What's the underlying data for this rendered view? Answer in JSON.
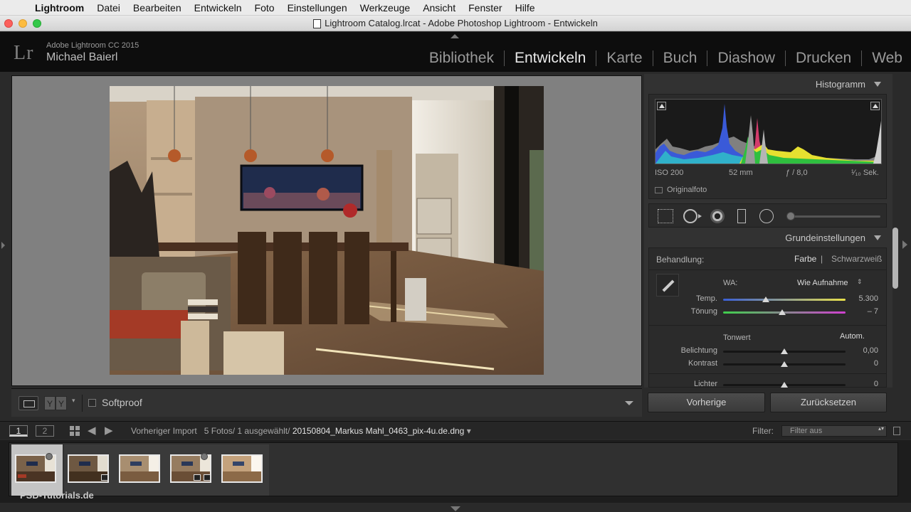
{
  "menubar": {
    "items": [
      "Lightroom",
      "Datei",
      "Bearbeiten",
      "Entwickeln",
      "Foto",
      "Einstellungen",
      "Werkzeuge",
      "Ansicht",
      "Fenster",
      "Hilfe"
    ]
  },
  "window": {
    "title": "Lightroom Catalog.lrcat - Adobe Photoshop Lightroom - Entwickeln"
  },
  "identity": {
    "logo": "Lr",
    "product": "Adobe Lightroom CC 2015",
    "user": "Michael Baierl"
  },
  "modules": [
    "Bibliothek",
    "Entwickeln",
    "Karte",
    "Buch",
    "Diashow",
    "Drucken",
    "Web"
  ],
  "toolbar": {
    "yy": [
      "Y",
      "Y"
    ],
    "softproof": "Softproof"
  },
  "histogram": {
    "title": "Histogramm",
    "iso": "ISO 200",
    "focal": "52 mm",
    "aperture": "ƒ / 8,0",
    "shutter": "¹⁄₁₀ Sek.",
    "original": "Originalfoto"
  },
  "basic": {
    "title": "Grundeinstellungen",
    "treatment_label": "Behandlung:",
    "treatment_color": "Farbe",
    "treatment_bw": "Schwarzweiß",
    "wb_label": "WA:",
    "wb_value": "Wie Aufnahme",
    "tone_label": "Tonwert",
    "auto_label": "Autom.",
    "sliders": [
      {
        "label": "Temp.",
        "value": "5.300",
        "position": 0.35
      },
      {
        "label": "Tönung",
        "value": "– 7",
        "position": 0.48
      },
      {
        "label": "Belichtung",
        "value": "0,00",
        "position": 0.5
      },
      {
        "label": "Kontrast",
        "value": "0",
        "position": 0.5
      },
      {
        "label": "Lichter",
        "value": "0",
        "position": 0.5
      }
    ]
  },
  "buttons": {
    "previous": "Vorherige",
    "reset": "Zurücksetzen"
  },
  "filmstrip": {
    "monitor1": "1",
    "monitor2": "2",
    "source": "Vorheriger Import",
    "count": "5 Fotos/ 1 ausgewählt/",
    "filename": "20150804_Markus Mahl_0463_pix-4u.de.dng",
    "filter_label": "Filter:",
    "filter_value": "Filter aus"
  },
  "watermark": "PSD-Tutorials.de"
}
